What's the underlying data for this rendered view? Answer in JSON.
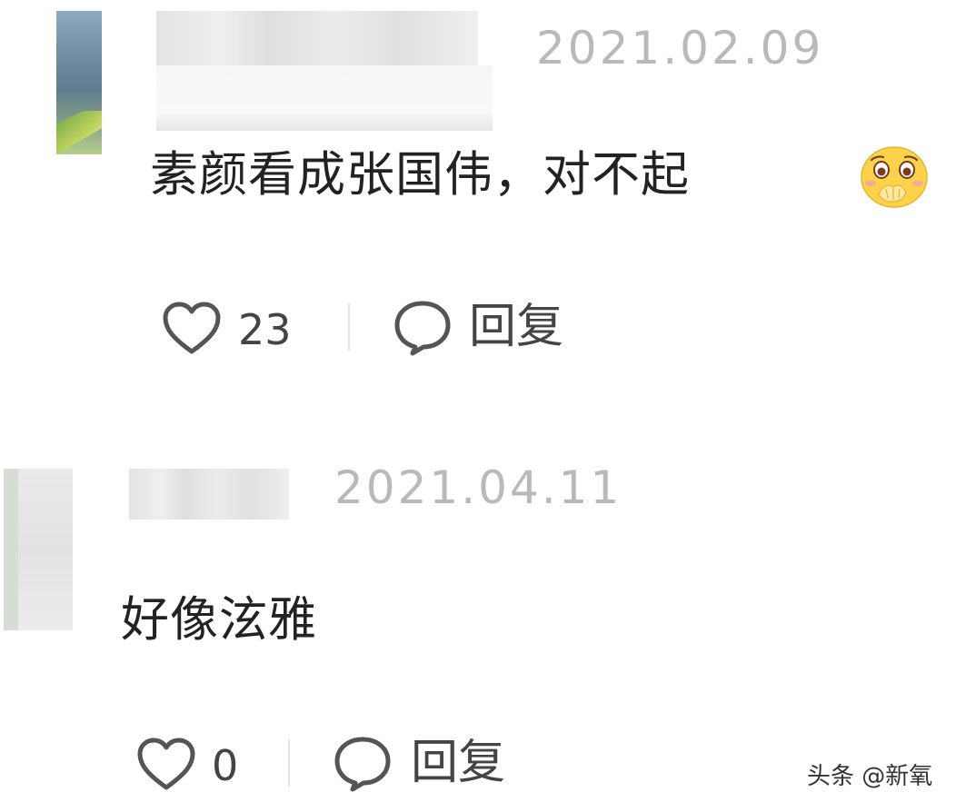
{
  "comments": [
    {
      "date": "2021.02.09",
      "text": "素颜看成张国伟，对不起",
      "emoji_icon": "pleading-face-hands-over-mouth-icon",
      "likes": "23",
      "reply_label": "回复"
    },
    {
      "date": "2021.04.11",
      "text": "好像泫雅",
      "likes": "0",
      "reply_label": "回复"
    }
  ],
  "icons": {
    "like": "heart-outline-icon",
    "reply": "speech-bubble-icon"
  },
  "watermark": "头条 @新氧",
  "colors": {
    "date": "#b9b9b9",
    "text": "#222222",
    "action": "#444444"
  }
}
